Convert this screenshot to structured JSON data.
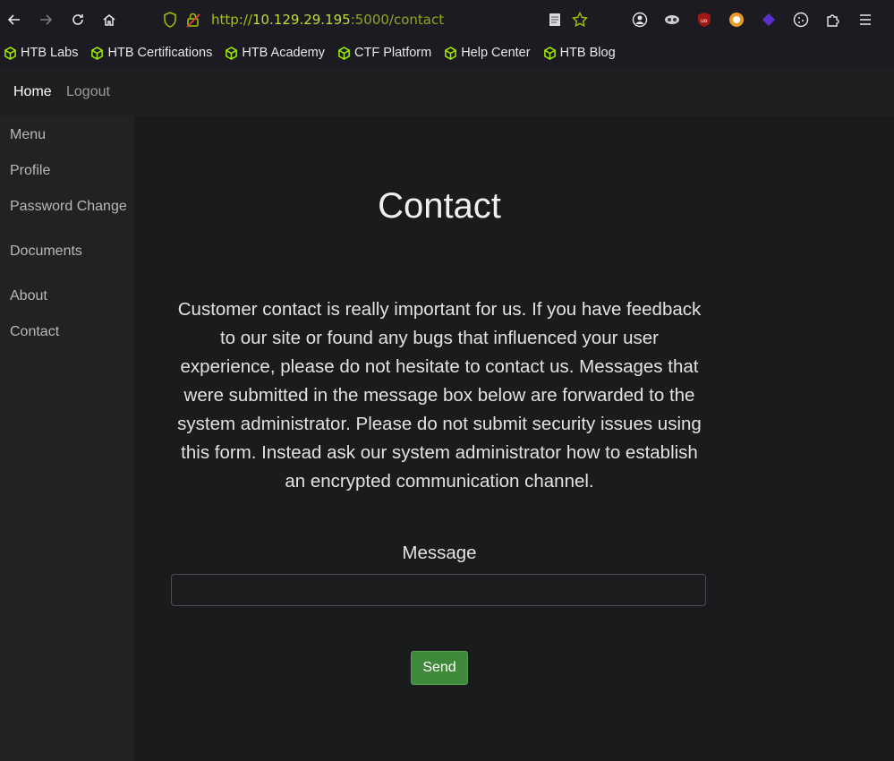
{
  "browser": {
    "url_scheme": "http://",
    "url_host": "10.129.29.195",
    "url_rest": ":5000/contact",
    "bookmarks": [
      "HTB Labs",
      "HTB Certifications",
      "HTB Academy",
      "CTF Platform",
      "Help Center",
      "HTB Blog"
    ],
    "colors": {
      "toolbar_bg": "#1c1b22",
      "url_green": "#a5c400",
      "htb_green": "#9fef00"
    }
  },
  "navbar": {
    "home_label": "Home",
    "logout_label": "Logout"
  },
  "sidebar": {
    "items": [
      {
        "label": "Menu"
      },
      {
        "label": "Profile"
      },
      {
        "label": "Password Change"
      },
      {
        "label": "Documents"
      },
      {
        "label": "About"
      },
      {
        "label": "Contact"
      }
    ]
  },
  "main": {
    "title": "Contact",
    "description": "Customer contact is really important for us. If you have feedback to our site or found any bugs that influenced your user experience, please do not hesitate to contact us. Messages that were submitted in the message box below are forwarded to the system administrator. Please do not submit security issues using this form. Instead ask our system administrator how to establish an encrypted communication channel.",
    "message_label": "Message",
    "message_value": "",
    "send_label": "Send",
    "colors": {
      "send_button": "#3f8a3a"
    }
  }
}
